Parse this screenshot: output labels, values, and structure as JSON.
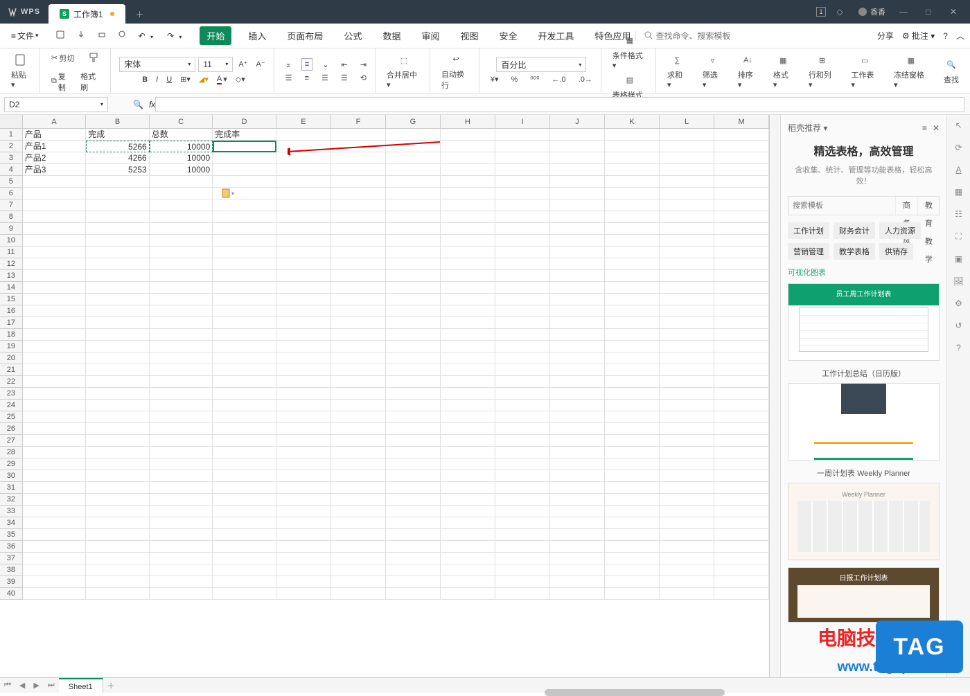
{
  "app": {
    "name": "WPS"
  },
  "tab": {
    "name": "工作簿1"
  },
  "user": {
    "name": "香香",
    "badge": "1"
  },
  "file_menu": "文件",
  "ribbon_tabs": [
    "开始",
    "插入",
    "页面布局",
    "公式",
    "数据",
    "审阅",
    "视图",
    "安全",
    "开发工具",
    "特色应用"
  ],
  "search": {
    "placeholder": "查找命令、搜索模板"
  },
  "share": "分享",
  "approve": "批注",
  "clipboard": {
    "paste": "粘贴",
    "cut": "剪切",
    "copy": "复制",
    "format_painter": "格式刷"
  },
  "font": {
    "name": "宋体",
    "size": "11",
    "bold": "B",
    "italic": "I",
    "underline": "U"
  },
  "align": {
    "merge": "合并居中",
    "wrap": "自动换行"
  },
  "num_format": {
    "sel": "百分比"
  },
  "groups": {
    "cond": "条件格式",
    "tbl": "表格样式",
    "sum": "求和",
    "filter": "筛选",
    "sort": "排序",
    "fmt": "格式",
    "rowcol": "行和列",
    "sheet": "工作表",
    "freeze": "冻结窗格",
    "find": "查找"
  },
  "namebox": "D2",
  "columns": [
    "A",
    "B",
    "C",
    "D",
    "E",
    "F",
    "G",
    "H",
    "I",
    "J",
    "K",
    "L",
    "M"
  ],
  "headers": {
    "A": "产品",
    "B": "完成",
    "C": "总数",
    "D": "完成率"
  },
  "rows": [
    {
      "A": "产品1",
      "B": "5266",
      "C": "10000"
    },
    {
      "A": "产品2",
      "B": "4266",
      "C": "10000"
    },
    {
      "A": "产品3",
      "B": "5253",
      "C": "10000"
    }
  ],
  "sheet": "Sheet1",
  "sidebar": {
    "title": "稻壳推荐",
    "headline": "精选表格，高效管理",
    "sub": "含收集、统计、管理等功能表格，轻松高效！",
    "search_ph": "搜索模板",
    "tab1": "商务风",
    "tab2": "教育教学",
    "cats": [
      "工作计划",
      "财务会计",
      "人力资源",
      "营销管理",
      "教学表格",
      "供销存"
    ],
    "section": "可视化图表",
    "tmpl1": "员工周工作计划表",
    "tmpl2": "工作计划总结（日历版）",
    "tmpl3": "一周计划表 Weekly Planner",
    "tmpl4": "日报工作计划表"
  },
  "watermark": {
    "site": "电脑技术网",
    "url": "www.tagxp.com",
    "tag": "TAG"
  }
}
